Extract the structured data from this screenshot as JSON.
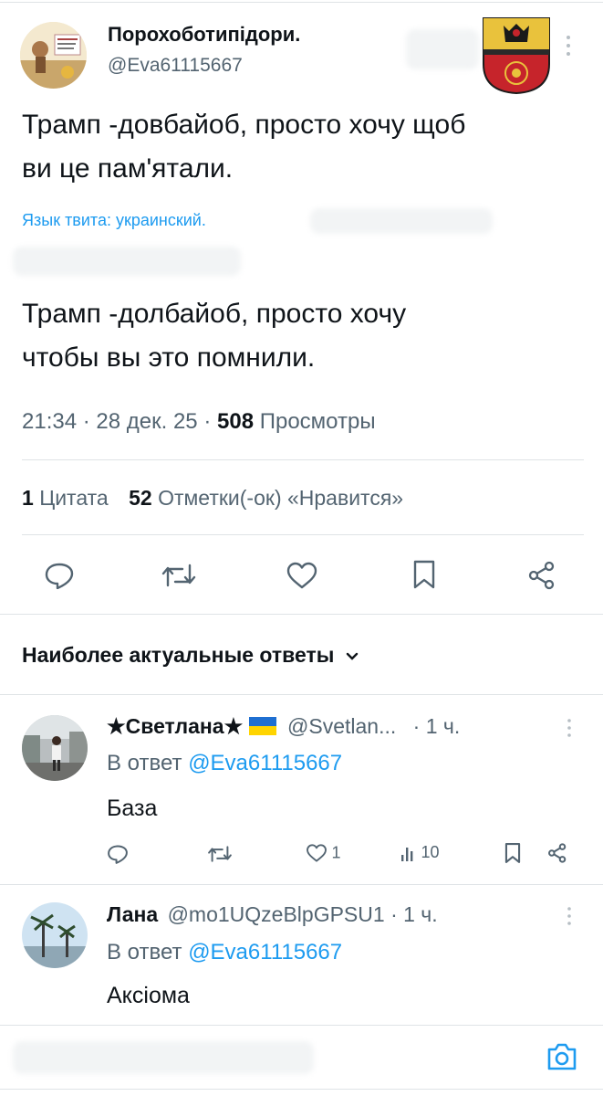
{
  "tweet": {
    "author_name": "Порохоботипідори.",
    "author_handle": "@Eva61115667",
    "text_line1": "Трамп -довбайоб, просто хочу щоб",
    "text_line2": "ви це пам'ятали.",
    "language_note": "Язык твита: украинский.",
    "translation_line1": "Трамп -долбайоб, просто хочу",
    "translation_line2": "чтобы вы это помнили.",
    "time": "21:34",
    "date": "28 дек. 25",
    "views_count": "508",
    "views_label": "Просмотры",
    "quotes_count": "1",
    "quotes_label": "Цитата",
    "likes_count": "52",
    "likes_label": "Отметки(-ок) «Нравится»",
    "dot": "·"
  },
  "replies_header": {
    "label": "Наиболее актуальные ответы"
  },
  "replies": [
    {
      "name": "★Светлана★",
      "handle": "@Svetlan...",
      "age": "· 1 ч.",
      "reply_to_prefix": "В ответ",
      "reply_to": "@Eva61115667",
      "text": "База",
      "likes": "1",
      "views": "10"
    },
    {
      "name": "Лана",
      "handle": "@mo1UQzeBlpGPSU1",
      "age": "· 1 ч.",
      "reply_to_prefix": "В ответ",
      "reply_to": "@Eva61115667",
      "text": "Аксіома"
    }
  ],
  "icons": {
    "reply": "reply-icon",
    "retweet": "retweet-icon",
    "like": "heart-icon",
    "bookmark": "bookmark-icon",
    "share": "share-icon",
    "views": "views-icon",
    "camera": "camera-icon",
    "more": "more-icon",
    "chevron": "chevron-down-icon"
  },
  "colors": {
    "accent": "#1d9bf0",
    "text": "#0f1419",
    "secondary": "#536471",
    "divider": "#dfe3e6"
  }
}
